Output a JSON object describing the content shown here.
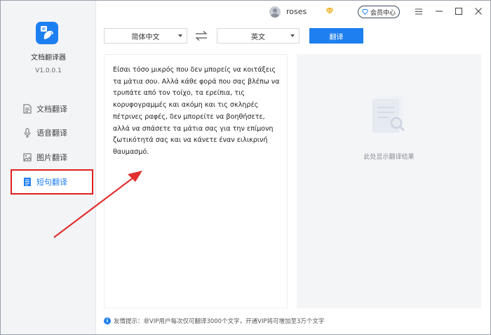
{
  "app": {
    "name": "文档翻译器",
    "version": "V1.0.0.1"
  },
  "sidebar": {
    "items": [
      {
        "label": "文档翻译",
        "icon": "document-icon"
      },
      {
        "label": "语音翻译",
        "icon": "microphone-icon"
      },
      {
        "label": "图片翻译",
        "icon": "image-icon"
      },
      {
        "label": "短句翻译",
        "icon": "sentence-icon",
        "active": true
      }
    ]
  },
  "header": {
    "username": "roses",
    "member_label": "会员中心"
  },
  "toolbar": {
    "source_lang": "简体中文",
    "target_lang": "英文",
    "translate_label": "翻译"
  },
  "source": {
    "text": "Είσαι τόσο μικρός που δεν μπορείς να κοιτάξεις τα μάτια σου. Αλλά κάθε φορά που σας βλέπω να τρυπάτε από τον τοίχο, τα ερείπια, τις κορυφογραμμές και ακόμη και τις σκληρές πέτρινες ραφές, δεν μπορείτε να βοηθήσετε, αλλά να σπάσετε τα μάτια σας για την επίμονη ζωτικότητά σας και να κάνετε έναν ειλικρινή θαυμασμό."
  },
  "result": {
    "empty_text": "此处显示翻译结果"
  },
  "footer": {
    "tip": "友情提示：非VIP用户每次仅可翻译3000个文字，开通VIP将可增加至3万个文字"
  },
  "colors": {
    "accent": "#1e7ff0",
    "highlight": "#e02020",
    "sidebar_bg": "#f3f4f6"
  }
}
